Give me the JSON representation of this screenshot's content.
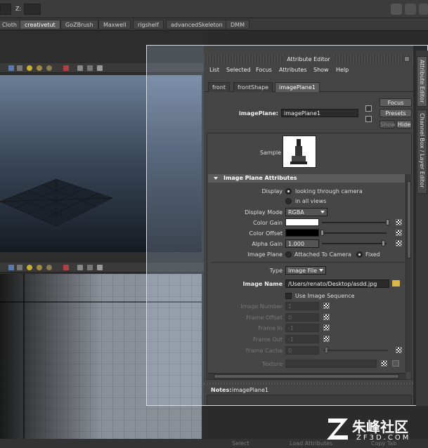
{
  "top": {
    "cloth_label": "Z:"
  },
  "shelf_tabs": [
    "Cloth",
    "creativetut",
    "GoZBrush",
    "Maxwell",
    "rigshelf",
    "advancedSkeleton",
    "DMM"
  ],
  "shelf_active": "creativetut",
  "attribute_editor": {
    "title": "Attribute Editor",
    "menus": [
      "List",
      "Selected",
      "Focus",
      "Attributes",
      "Show",
      "Help"
    ],
    "tabs": [
      "front",
      "frontShape",
      "imagePlane1"
    ],
    "active_tab": "imagePlane1",
    "node_label": "imagePlane:",
    "node_value": "imagePlane1",
    "buttons": {
      "focus": "Focus",
      "presets": "Presets",
      "show": "Show",
      "hide": "Hide"
    },
    "sample_label": "Sample",
    "section_title": "Image Plane Attributes",
    "display_label": "Display",
    "display_opt1": "looking through camera",
    "display_opt2": "in all views",
    "display_mode_label": "Display Mode",
    "display_mode_value": "RGBA",
    "color_gain_label": "Color Gain",
    "color_offset_label": "Color Offset",
    "alpha_gain_label": "Alpha Gain",
    "alpha_gain_value": "1.000",
    "image_plane_label": "Image Plane",
    "image_plane_opt1": "Attached To Camera",
    "image_plane_opt2": "Fixed",
    "type_label": "Type",
    "type_value": "Image File",
    "image_name_label": "Image Name",
    "image_name_value": "/Users/renato/Desktop/asdd.jpg",
    "use_sequence_label": "Use Image Sequence",
    "image_number_label": "Image Number",
    "image_number_value": "1",
    "frame_offset_label": "Frame Offset",
    "frame_offset_value": "0",
    "frame_in_label": "Frame In",
    "frame_in_value": "-1",
    "frame_out_label": "Frame Out",
    "frame_out_value": "-1",
    "frame_cache_label": "Frame Cache",
    "frame_cache_value": "0",
    "texture_label": "Texture",
    "notes_label": "Notes:",
    "notes_value": "imagePlane1"
  },
  "side_tabs": {
    "attribute_editor": "Attribute Editor",
    "channel_box": "Channel Box / Layer Editor"
  },
  "bottom": {
    "select": "Select",
    "load": "Load Attributes",
    "copy": "Copy Tab"
  },
  "watermark": {
    "brand": "朱峰社区",
    "url": "ZF3D.COM"
  }
}
